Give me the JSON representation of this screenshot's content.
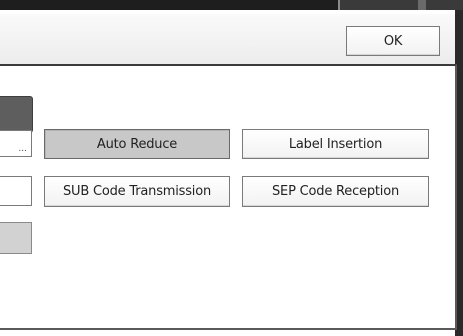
{
  "header": {
    "ok_label": "OK"
  },
  "options": {
    "left_ellipsis": "...",
    "auto_reduce": "Auto Reduce",
    "label_insertion": "Label Insertion",
    "sub_code_transmission": "SUB Code Transmission",
    "sep_code_reception": "SEP Code Reception"
  },
  "state": {
    "selected_option": "Auto Reduce"
  }
}
